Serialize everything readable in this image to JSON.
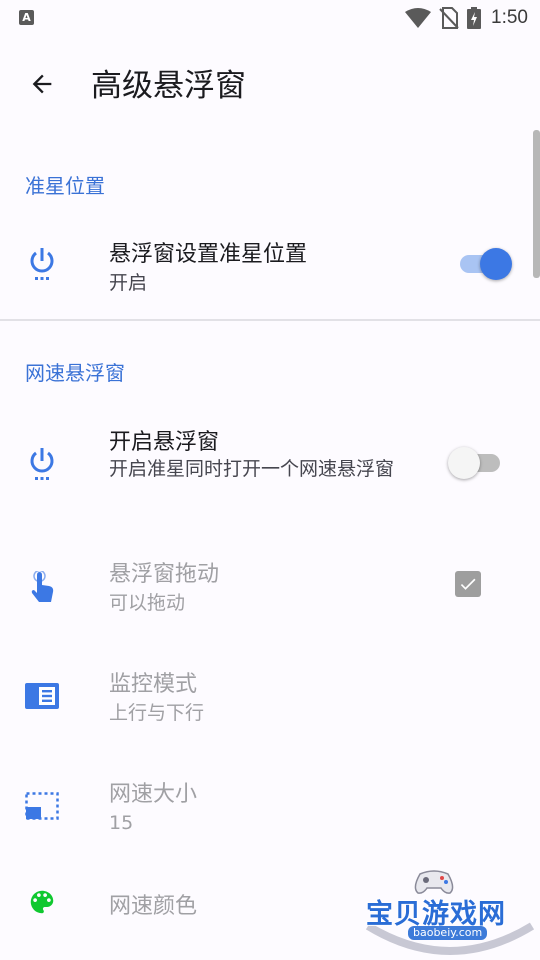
{
  "status_bar": {
    "time": "1:50",
    "icons": [
      "a-notification-icon",
      "wifi-icon",
      "no-sim-icon",
      "battery-charging-icon"
    ]
  },
  "app_bar": {
    "title": "高级悬浮窗",
    "back_icon": "arrow-back-icon"
  },
  "sections": [
    {
      "header": "准星位置",
      "items": [
        {
          "title": "悬浮窗设置准星位置",
          "summary": "开启",
          "icon": "power-icon",
          "widget": "switch",
          "checked": true,
          "enabled": true
        }
      ]
    },
    {
      "header": "网速悬浮窗",
      "items": [
        {
          "title": "开启悬浮窗",
          "summary": "开启准星同时打开一个网速悬浮窗",
          "icon": "power-icon",
          "widget": "switch",
          "checked": false,
          "enabled": true
        },
        {
          "title": "悬浮窗拖动",
          "summary": "可以拖动",
          "icon": "touch-icon",
          "widget": "checkbox",
          "checked": true,
          "enabled": false
        },
        {
          "title": "监控模式",
          "summary": "上行与下行",
          "icon": "view-list-icon",
          "enabled": false
        },
        {
          "title": "网速大小",
          "summary": "15",
          "icon": "picture-in-picture-icon",
          "enabled": false
        },
        {
          "title": "网速颜色",
          "icon": "palette-icon",
          "enabled": false
        }
      ]
    }
  ],
  "colors": {
    "accent": "#3c78e4",
    "category_text": "#3a72d6",
    "palette_icon": "#10c830",
    "background": "#fdfbff"
  },
  "watermark": {
    "text": "宝贝游戏网",
    "url": "baobeiy.com"
  }
}
